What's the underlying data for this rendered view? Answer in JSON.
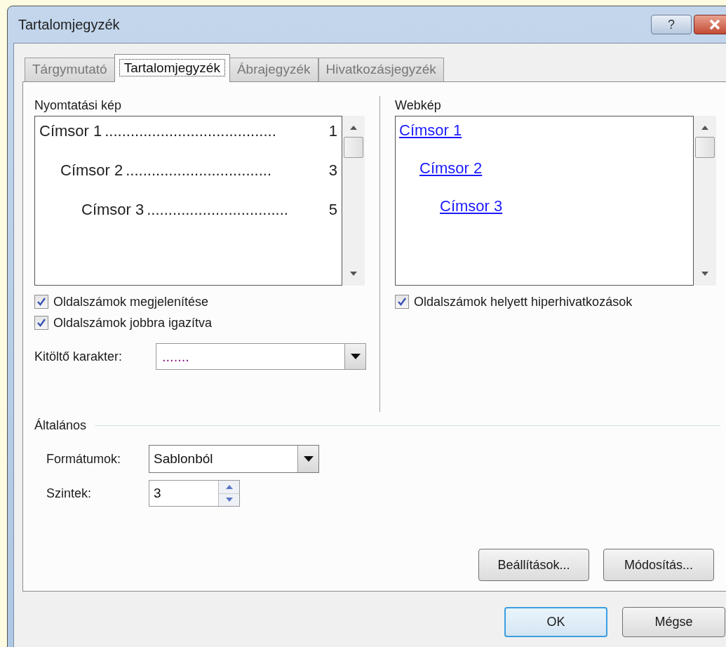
{
  "window": {
    "title": "Tartalomjegyzék",
    "help_button": "?"
  },
  "tabs": [
    {
      "label": "Tárgymutató",
      "selected": false
    },
    {
      "label": "Tartalomjegyzék",
      "selected": true
    },
    {
      "label": "Ábrajegyzék",
      "selected": false
    },
    {
      "label": "Hivatkozásjegyzék",
      "selected": false
    }
  ],
  "print_preview": {
    "label": "Nyomtatási kép",
    "entries": [
      {
        "text": "Címsor 1",
        "leader": "........................................",
        "page": "1",
        "children": [
          {
            "text": "Címsor 2",
            "leader": "..................................",
            "page": "3",
            "children": [
              {
                "text": "Címsor 3",
                "leader": ".................................",
                "page": "5"
              }
            ]
          }
        ]
      }
    ]
  },
  "web_preview": {
    "label": "Webkép",
    "entries": [
      {
        "text": "Címsor 1",
        "children": [
          {
            "text": "Címsor 2",
            "children": [
              {
                "text": "Címsor 3"
              }
            ]
          }
        ]
      }
    ]
  },
  "left_options": [
    {
      "label": "Oldalszámok megjelenítése",
      "checked": true
    },
    {
      "label": "Oldalszámok jobbra igazítva",
      "checked": true
    }
  ],
  "tab_leader": {
    "label": "Kitöltő karakter:",
    "value": "......."
  },
  "right_options": [
    {
      "label": "Oldalszámok helyett hiperhivatkozások",
      "checked": true
    }
  ],
  "general": {
    "label": "Általános",
    "formats": {
      "label": "Formátumok:",
      "value": "Sablonból"
    },
    "levels": {
      "label": "Szintek:",
      "value": "3"
    }
  },
  "panel_buttons": [
    "Beállítások...",
    "Módosítás..."
  ],
  "dialog_buttons": [
    {
      "label": "OK",
      "default": true
    },
    {
      "label": "Mégse",
      "default": false
    }
  ]
}
